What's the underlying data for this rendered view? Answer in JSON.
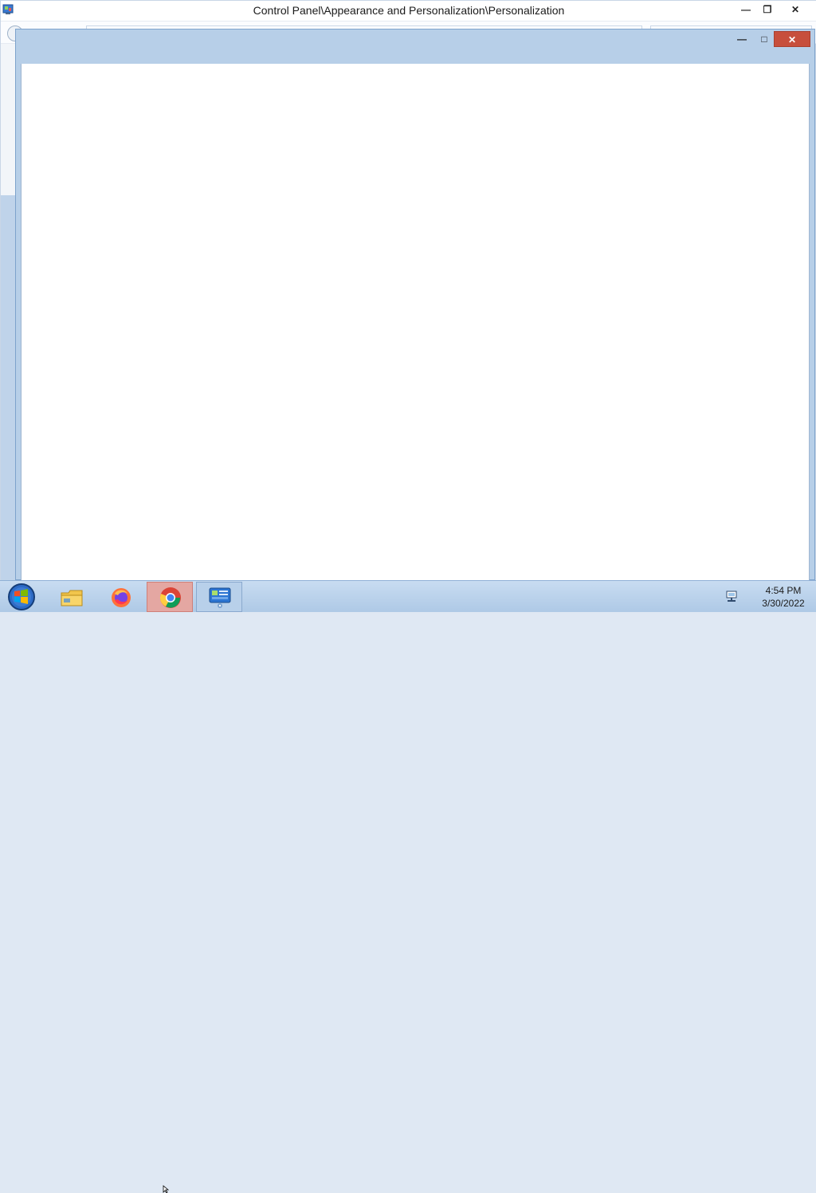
{
  "background_window": {
    "title": "Control Panel\\Appearance and Personalization\\Personalization",
    "controls": {
      "minimize": "—",
      "restore": "❐",
      "close": "✕"
    }
  },
  "foreground_window": {
    "controls": {
      "minimize": "—",
      "maximize": "□",
      "close": "✕"
    }
  },
  "taskbar": {
    "items": [
      {
        "name": "file-explorer",
        "icon": "folder-icon"
      },
      {
        "name": "firefox",
        "icon": "firefox-icon"
      },
      {
        "name": "chrome",
        "icon": "chrome-icon",
        "active": true
      },
      {
        "name": "control-panel",
        "icon": "control-panel-icon"
      }
    ],
    "clock": {
      "time": "4:54 PM",
      "date": "3/30/2022"
    }
  }
}
